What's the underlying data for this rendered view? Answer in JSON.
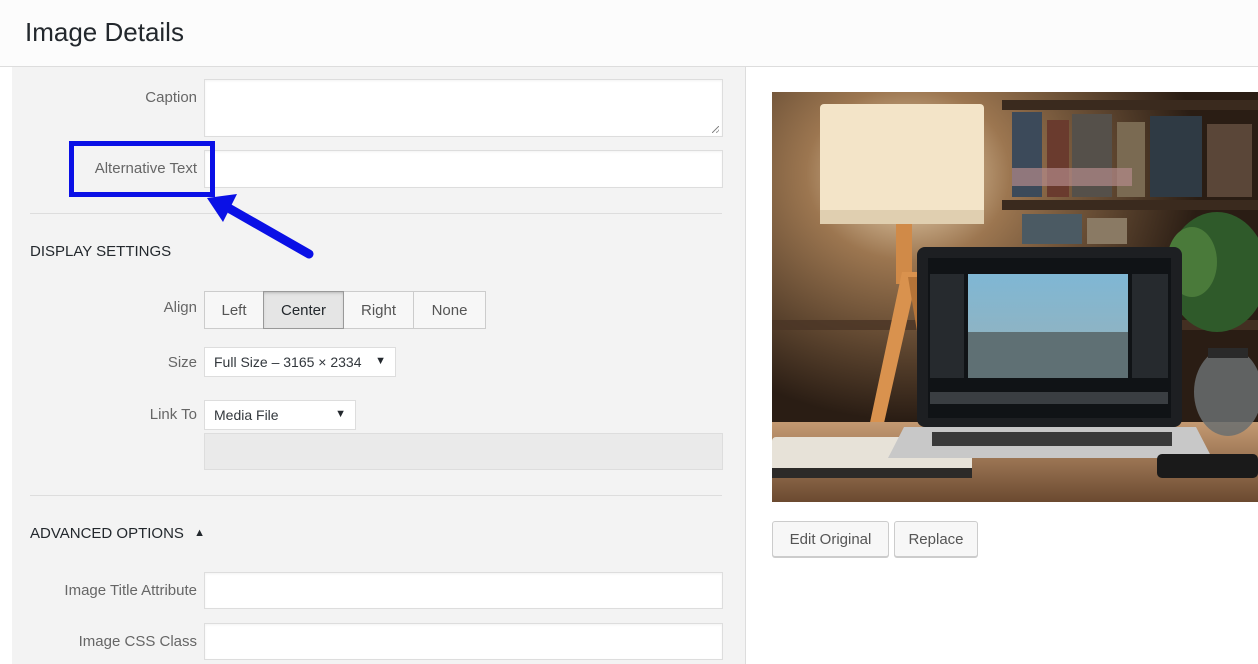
{
  "header": {
    "title": "Image Details"
  },
  "fields": {
    "caption": {
      "label": "Caption",
      "value": ""
    },
    "alt_text": {
      "label": "Alternative Text",
      "value": ""
    }
  },
  "display_settings": {
    "heading": "DISPLAY SETTINGS",
    "align": {
      "label": "Align",
      "options": [
        "Left",
        "Center",
        "Right",
        "None"
      ],
      "selected": "Center"
    },
    "size": {
      "label": "Size",
      "value": "Full Size – 3165 × 2334",
      "arrow": "▼"
    },
    "link_to": {
      "label": "Link To",
      "value": "Media File",
      "arrow": "▼",
      "url_value": ""
    }
  },
  "advanced": {
    "heading": "ADVANCED OPTIONS",
    "toggle_icon": "▲",
    "title_attr": {
      "label": "Image Title Attribute",
      "value": ""
    },
    "css_class": {
      "label": "Image CSS Class",
      "value": ""
    }
  },
  "preview": {
    "image_icon": "desk-laptop-lamp-photo",
    "edit_button": "Edit Original",
    "replace_button": "Replace"
  },
  "annotation": {
    "highlight_color": "#0a10e6",
    "arrow_color": "#0a10e6"
  }
}
